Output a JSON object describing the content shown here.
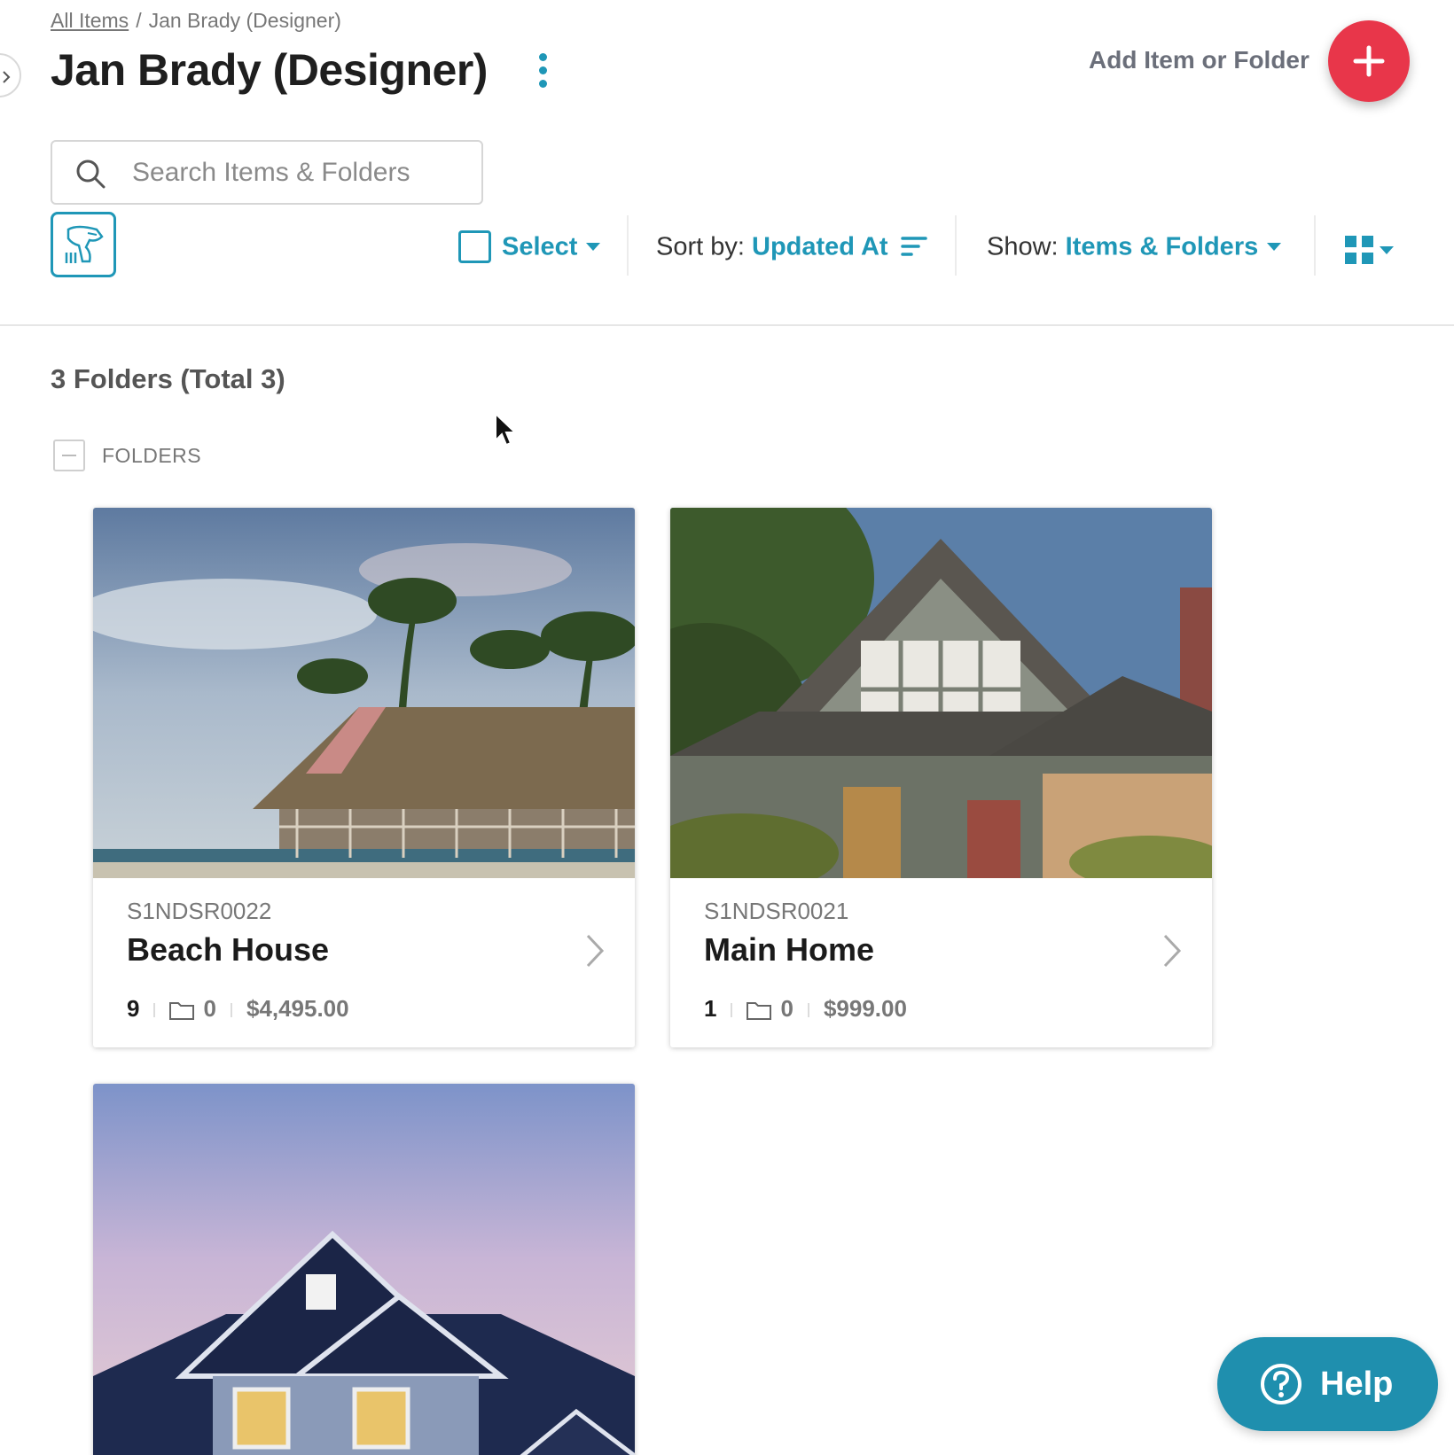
{
  "breadcrumb": {
    "root_link": "All Items",
    "separator": "/",
    "current": "Jan Brady (Designer)"
  },
  "header": {
    "title": "Jan Brady (Designer)",
    "add_label": "Add Item or Folder"
  },
  "search": {
    "placeholder": "Search Items & Folders"
  },
  "toolbar": {
    "select_label": "Select",
    "sort_prefix": "Sort by:",
    "sort_value": "Updated At",
    "show_prefix": "Show:",
    "show_value": "Items & Folders"
  },
  "folders": {
    "summary": "3 Folders (Total 3)",
    "section_label": "FOLDERS",
    "cards": [
      {
        "code": "S1NDSR0022",
        "name": "Beach House",
        "item_count": "9",
        "folder_count": "0",
        "value": "$4,495.00",
        "image": "beach-house-photo"
      },
      {
        "code": "S1NDSR0021",
        "name": "Main Home",
        "item_count": "1",
        "folder_count": "0",
        "value": "$999.00",
        "image": "craftsman-house-photo"
      },
      {
        "image": "blue-house-photo"
      }
    ]
  },
  "help": {
    "label": "Help"
  },
  "colors": {
    "accent": "#1f97b7",
    "add_button": "#e8364a",
    "help_button": "#1f8fae"
  },
  "icons": [
    "chevron-right-icon",
    "kebab-menu-icon",
    "plus-icon",
    "search-icon",
    "barcode-scanner-icon",
    "sort-icon",
    "grid-view-icon",
    "folder-icon",
    "question-icon"
  ]
}
